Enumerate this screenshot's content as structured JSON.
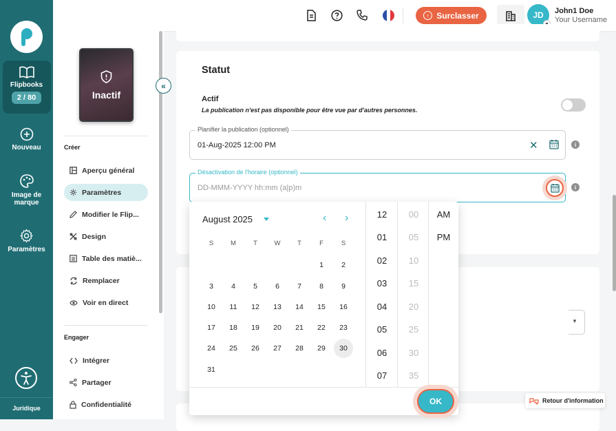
{
  "sidebar": {
    "flipbooks_label": "Flipbooks",
    "flipbooks_count": "2 / 80",
    "new_label": "Nouveau",
    "brand_label_1": "Image de",
    "brand_label_2": "marque",
    "settings_label": "Paramètres",
    "legal_label": "Juridique"
  },
  "topbar": {
    "upgrade_label": "Surclasser",
    "user_initials": "JD",
    "user_name": "John1 Doe",
    "user_sub": "Your Username"
  },
  "publication": {
    "status_label": "Inactif"
  },
  "menu": {
    "create_title": "Créer",
    "engage_title": "Engager",
    "items": [
      {
        "label": "Aperçu général",
        "icon": "overview-icon"
      },
      {
        "label": "Paramètres",
        "icon": "gear-icon"
      },
      {
        "label": "Modifier le Flip...",
        "icon": "pencil-icon"
      },
      {
        "label": "Design",
        "icon": "design-icon"
      },
      {
        "label": "Table des matiè...",
        "icon": "toc-icon"
      },
      {
        "label": "Remplacer",
        "icon": "replace-icon"
      },
      {
        "label": "Voir en direct",
        "icon": "eye-icon"
      }
    ],
    "engage_items": [
      {
        "label": "Intégrer",
        "icon": "code-icon"
      },
      {
        "label": "Partager",
        "icon": "share-icon"
      },
      {
        "label": "Confidentialité",
        "icon": "lock-icon"
      }
    ]
  },
  "statut": {
    "title": "Statut",
    "actif_label": "Actif",
    "actif_desc": "La publication n'est pas disponible pour être vue par d'autres personnes.",
    "toggle_on": false,
    "schedule_legend": "Planifier la publication (optionnel)",
    "schedule_value": "01-Aug-2025 12:00 PM",
    "deactivation_legend": "Désactivation de l'horaire (optionnel)",
    "deactivation_placeholder": "DD-MMM-YYYY hh:mm (a|p)m"
  },
  "picker": {
    "month_label": "August 2025",
    "weekdays": [
      "S",
      "M",
      "T",
      "W",
      "T",
      "F",
      "S"
    ],
    "weeks": [
      [
        "",
        "",
        "",
        "",
        "",
        "1",
        "2"
      ],
      [
        "3",
        "4",
        "5",
        "6",
        "7",
        "8",
        "9"
      ],
      [
        "10",
        "11",
        "12",
        "13",
        "14",
        "15",
        "16"
      ],
      [
        "17",
        "18",
        "19",
        "20",
        "21",
        "22",
        "23"
      ],
      [
        "24",
        "25",
        "26",
        "27",
        "28",
        "29",
        "30"
      ],
      [
        "31",
        "",
        "",
        "",
        "",
        "",
        ""
      ]
    ],
    "today": "30",
    "hours": [
      "12",
      "01",
      "02",
      "03",
      "04",
      "05",
      "06",
      "07"
    ],
    "minutes": [
      "00",
      "05",
      "10",
      "15",
      "20",
      "25",
      "30",
      "35"
    ],
    "meridiem": [
      "AM",
      "PM"
    ],
    "ok_label": "OK"
  },
  "feedback_label": "Retour d'information",
  "colors": {
    "rail": "#1f6d73",
    "accent": "#36b8c9",
    "upgrade": "#e96443"
  }
}
